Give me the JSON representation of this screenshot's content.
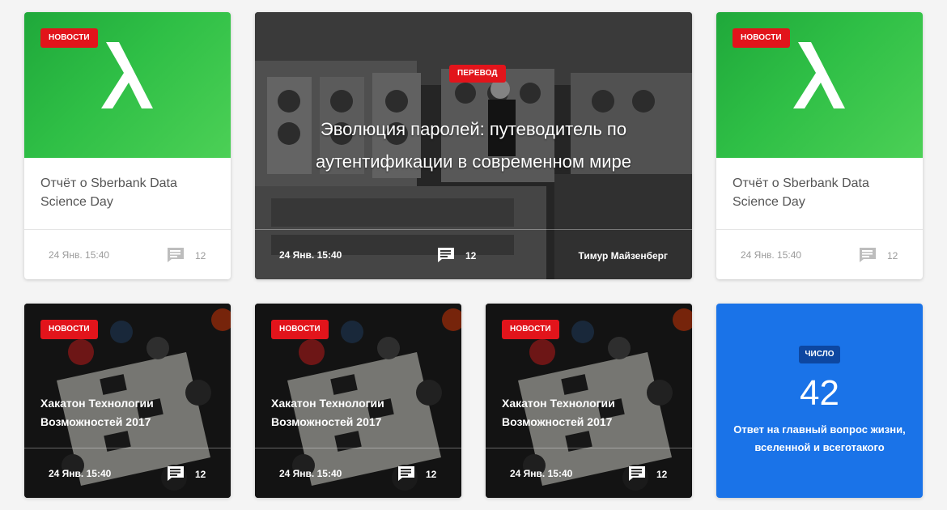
{
  "cards_top": [
    {
      "badge": "НОВОСТИ",
      "title": "Отчёт о Sberbank Data Science Day",
      "date": "24 Янв. 15:40",
      "comments": "12"
    },
    {
      "badge": "ПЕРЕВОД",
      "title": "Эволюция паролей: путеводитель по аутентификации в современном мире",
      "date": "24 Янв. 15:40",
      "comments": "12",
      "author": "Тимур Майзенберг"
    },
    {
      "badge": "НОВОСТИ",
      "title": "Отчёт о Sberbank Data Science Day",
      "date": "24 Янв. 15:40",
      "comments": "12"
    }
  ],
  "cards_bottom": [
    {
      "badge": "НОВОСТИ",
      "title": "Хакатон Технологии Возможностей 2017",
      "date": "24 Янв. 15:40",
      "comments": "12"
    },
    {
      "badge": "НОВОСТИ",
      "title": "Хакатон Технологии Возможностей 2017",
      "date": "24 Янв. 15:40",
      "comments": "12"
    },
    {
      "badge": "НОВОСТИ",
      "title": "Хакатон Технологии Возможностей 2017",
      "date": "24 Янв. 15:40",
      "comments": "12"
    }
  ],
  "number_card": {
    "badge": "ЧИСЛО",
    "value": "42",
    "caption": "Ответ на главный вопрос жизни, вселенной и всеготакого"
  },
  "colors": {
    "badge_red": "#e2141b",
    "green": "#2fbf46",
    "blue": "#1a73e8",
    "navy_badge": "#0d47a1"
  },
  "icons": {
    "comment": "comment-icon",
    "lambda": "lambda-logo-icon"
  }
}
